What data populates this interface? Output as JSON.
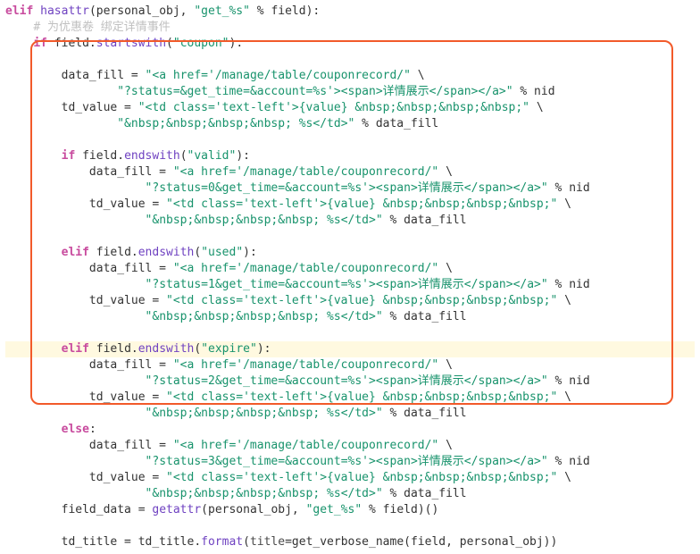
{
  "lines": [
    {
      "t": "elif_hasattr",
      "kw1": "elif",
      "fn": "hasattr",
      "args": "(personal_obj, ",
      "str": "\"get_%s\"",
      "rest": " % field):",
      "indent": 0
    },
    {
      "t": "comment",
      "text": "# 为优惠卷 绑定详情事件",
      "indent": 1
    },
    {
      "t": "if_startswith",
      "kw": "if",
      "var": "field",
      "fn": "startswith",
      "str": "\"coupon\"",
      "indent": 1
    },
    {
      "t": "blank"
    },
    {
      "t": "assign_str",
      "var": "data_fill",
      "str": "\"<a href='/manage/table/couponrecord/\"",
      "cont": " \\",
      "indent": 2
    },
    {
      "t": "cont_str",
      "str": "\"?status=&get_time=&account=%s'><span>详情展示</span></a>\"",
      "rest": " % nid",
      "indent": 4
    },
    {
      "t": "assign_str",
      "var": "td_value",
      "str": "\"<td class='text-left'>{value} &nbsp;&nbsp;&nbsp;&nbsp;\"",
      "cont": " \\",
      "indent": 2
    },
    {
      "t": "cont_str",
      "str": "\"&nbsp;&nbsp;&nbsp;&nbsp; %s</td>\"",
      "rest": " % data_fill",
      "indent": 4
    },
    {
      "t": "blank"
    },
    {
      "t": "if_endswith",
      "kw": "if",
      "var": "field",
      "fn": "endswith",
      "str": "\"valid\"",
      "indent": 2
    },
    {
      "t": "assign_str",
      "var": "data_fill",
      "str": "\"<a href='/manage/table/couponrecord/\"",
      "cont": " \\",
      "indent": 3
    },
    {
      "t": "cont_str",
      "str": "\"?status=0&get_time=&account=%s'><span>详情展示</span></a>\"",
      "rest": " % nid",
      "indent": 5
    },
    {
      "t": "assign_str",
      "var": "td_value",
      "str": "\"<td class='text-left'>{value} &nbsp;&nbsp;&nbsp;&nbsp;\"",
      "cont": " \\",
      "indent": 3
    },
    {
      "t": "cont_str",
      "str": "\"&nbsp;&nbsp;&nbsp;&nbsp; %s</td>\"",
      "rest": " % data_fill",
      "indent": 5
    },
    {
      "t": "blank"
    },
    {
      "t": "elif_endswith",
      "kw": "elif",
      "var": "field",
      "fn": "endswith",
      "str": "\"used\"",
      "indent": 2
    },
    {
      "t": "assign_str",
      "var": "data_fill",
      "str": "\"<a href='/manage/table/couponrecord/\"",
      "cont": " \\",
      "indent": 3
    },
    {
      "t": "cont_str",
      "str": "\"?status=1&get_time=&account=%s'><span>详情展示</span></a>\"",
      "rest": " % nid",
      "indent": 5
    },
    {
      "t": "assign_str",
      "var": "td_value",
      "str": "\"<td class='text-left'>{value} &nbsp;&nbsp;&nbsp;&nbsp;\"",
      "cont": " \\",
      "indent": 3
    },
    {
      "t": "cont_str",
      "str": "\"&nbsp;&nbsp;&nbsp;&nbsp; %s</td>\"",
      "rest": " % data_fill",
      "indent": 5
    },
    {
      "t": "blank"
    },
    {
      "t": "elif_endswith",
      "kw": "elif",
      "var": "field",
      "fn": "endswith",
      "str": "\"expire\"",
      "indent": 2,
      "hl": true
    },
    {
      "t": "assign_str",
      "var": "data_fill",
      "str": "\"<a href='/manage/table/couponrecord/\"",
      "cont": " \\",
      "indent": 3
    },
    {
      "t": "cont_str",
      "str": "\"?status=2&get_time=&account=%s'><span>详情展示</span></a>\"",
      "rest": " % nid",
      "indent": 5
    },
    {
      "t": "assign_str",
      "var": "td_value",
      "str": "\"<td class='text-left'>{value} &nbsp;&nbsp;&nbsp;&nbsp;\"",
      "cont": " \\",
      "indent": 3
    },
    {
      "t": "cont_str",
      "str": "\"&nbsp;&nbsp;&nbsp;&nbsp; %s</td>\"",
      "rest": " % data_fill",
      "indent": 5
    },
    {
      "t": "else",
      "kw": "else",
      "indent": 2
    },
    {
      "t": "assign_str",
      "var": "data_fill",
      "str": "\"<a href='/manage/table/couponrecord/\"",
      "cont": " \\",
      "indent": 3
    },
    {
      "t": "cont_str",
      "str": "\"?status=3&get_time=&account=%s'><span>详情展示</span></a>\"",
      "rest": " % nid",
      "indent": 5
    },
    {
      "t": "assign_str",
      "var": "td_value",
      "str": "\"<td class='text-left'>{value} &nbsp;&nbsp;&nbsp;&nbsp;\"",
      "cont": " \\",
      "indent": 3
    },
    {
      "t": "cont_str",
      "str": "\"&nbsp;&nbsp;&nbsp;&nbsp; %s</td>\"",
      "rest": " % data_fill",
      "indent": 5
    },
    {
      "t": "assign_call",
      "var": "field_data",
      "fn": "getattr",
      "args": "(personal_obj, ",
      "str": "\"get_%s\"",
      "rest": " % field)()",
      "indent": 2
    },
    {
      "t": "blank"
    },
    {
      "t": "assign_format",
      "indent": 2
    }
  ]
}
